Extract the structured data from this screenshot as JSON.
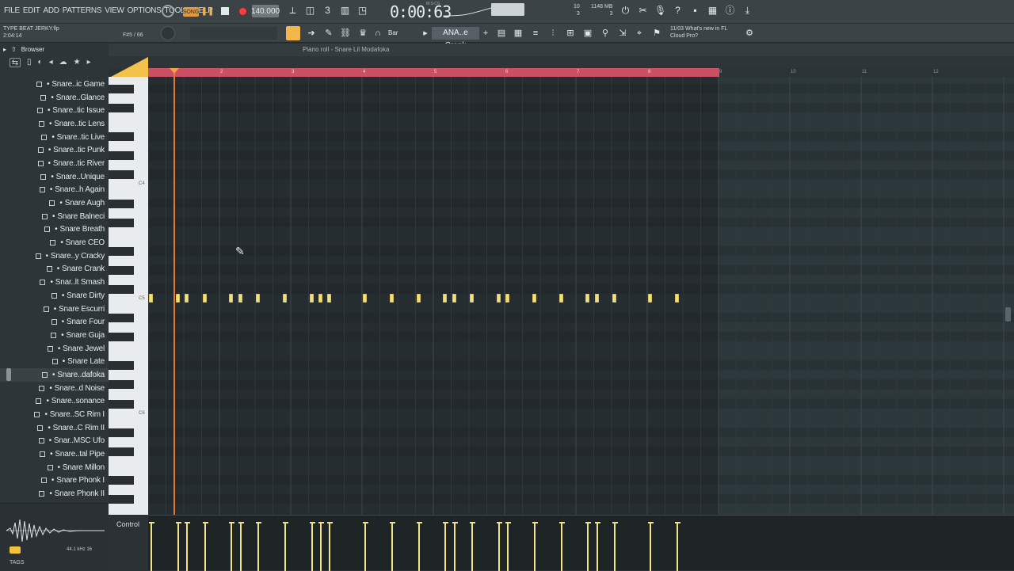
{
  "menu": [
    "FILE",
    "EDIT",
    "ADD",
    "PATTERNS",
    "VIEW",
    "OPTIONS",
    "TOOLS",
    "HELP"
  ],
  "transport": {
    "mode": "SONG",
    "tempo": "140.000",
    "time": "0:00:63",
    "time_sub": "M:S:CS"
  },
  "monitor": {
    "poly": "10",
    "poly2": "3",
    "memory": "1148 MB",
    "cpu": "3"
  },
  "project": {
    "name": "TYPE BEAT JERKY.flp",
    "time": "2:04:14",
    "fps": "F#5 / 66"
  },
  "toolbar2": {
    "snap": "Bar",
    "pattern": "ANA..e Crank"
  },
  "news": {
    "date": "11/03",
    "line1": "What's new in FL",
    "line2": "Cloud Pro?"
  },
  "browser": {
    "title": "Browser",
    "items": [
      "Snare..ic Game",
      "Snare..Glance",
      "Snare..tic Issue",
      "Snare..tic Lens",
      "Snare..tic Live",
      "Snare..tic Punk",
      "Snare..tic River",
      "Snare..Unique",
      "Snare..h Again",
      "Snare Augh",
      "Snare Balneci",
      "Snare Breath",
      "Snare CEO",
      "Snare..y Cracky",
      "Snare Crank",
      "Snar..lt Smash",
      "Snare Dirty",
      "Snare Escurri",
      "Snare Four",
      "Snare Guja",
      "Snare Jewel",
      "Snare Late",
      "Snare..dafoka",
      "Snare..d Noise",
      "Snare..sonance",
      "Snare..SC Rim I",
      "Snare..C Rim II",
      "Snar..MSC Ufo",
      "Snare..tal Pipe",
      "Snare Millon",
      "Snare Phonk I",
      "Snare Phonk II"
    ],
    "selected_index": 22,
    "sample_info": "44.1 kHz 16",
    "tags": "TAGS"
  },
  "piano_roll": {
    "title": "Piano roll - Snare Lil Modafoka",
    "key_labels": [
      "C6",
      "C5",
      "C4"
    ],
    "bar_numbers": [
      "2",
      "3",
      "4",
      "5",
      "6",
      "7",
      "8",
      "9",
      "10",
      "11",
      "12"
    ],
    "loop_bars": 8,
    "control_label": "Control",
    "note_pitch": "C5",
    "note_starts_bars": [
      1.0,
      1.375,
      1.5,
      1.75,
      2.125,
      2.25,
      2.5,
      2.875,
      3.25,
      3.375,
      3.5,
      4.0,
      4.375,
      4.75,
      5.125,
      5.25,
      5.5,
      5.875,
      6.0,
      6.375,
      6.75,
      7.125,
      7.25,
      7.5,
      8.0,
      8.375
    ],
    "note_velocity": 1.0
  },
  "colors": {
    "note": "#f3e07a",
    "loop": "#cc5064",
    "playhead": "#e07a2a",
    "accent": "#f3c24a"
  }
}
